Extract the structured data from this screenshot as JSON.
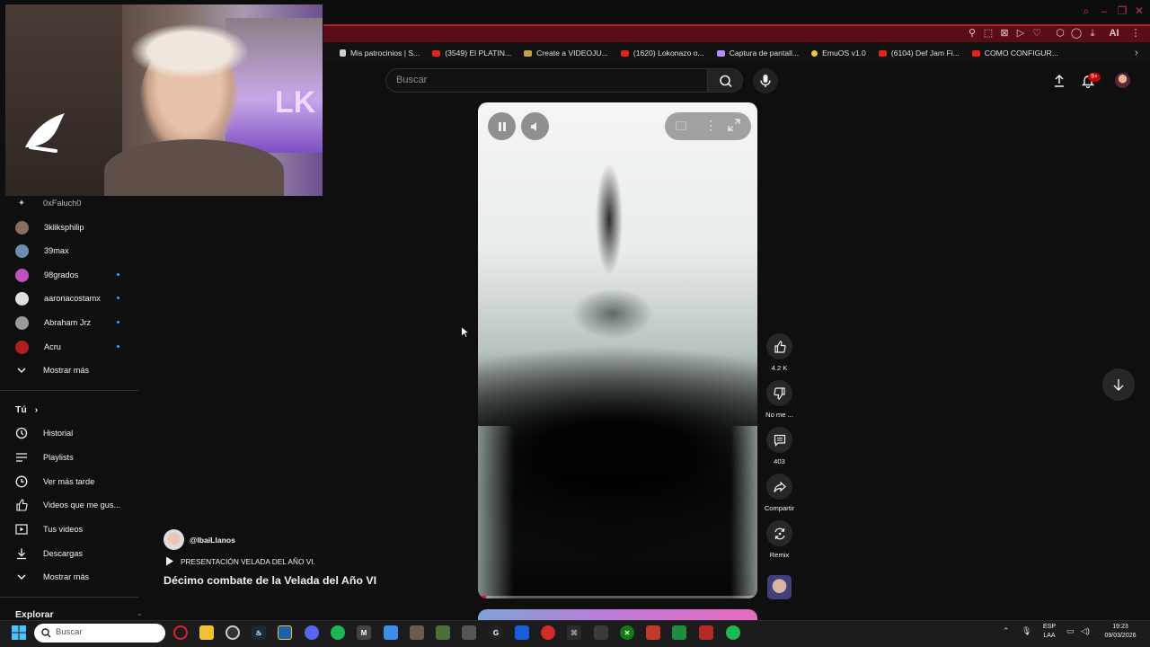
{
  "browser": {
    "bookmarks": [
      {
        "icon": "document-icon",
        "label": "Mis patrocinios | S..."
      },
      {
        "icon": "youtube-icon",
        "label": "(3549) El PLATIN..."
      },
      {
        "icon": "document-icon",
        "label": "Create a VIDEOJU..."
      },
      {
        "icon": "youtube-icon",
        "label": "(1620) Lokonazo o..."
      },
      {
        "icon": "pen-icon",
        "label": "Captura de pantall..."
      },
      {
        "icon": "emulator-icon",
        "label": "EmuOS v1.0"
      },
      {
        "icon": "youtube-icon",
        "label": "(6104) Def Jam Fi..."
      },
      {
        "icon": "youtube-icon",
        "label": "COMO CONFIGUR..."
      }
    ],
    "ai_label": "AI"
  },
  "header": {
    "search_placeholder": "Buscar",
    "notifications_badge": "9+"
  },
  "sidebar": {
    "channels": [
      {
        "name": "0xFaluch0",
        "live": false,
        "color": "#555555"
      },
      {
        "name": "3kliksphilip",
        "live": false,
        "color": "#8a6d5a"
      },
      {
        "name": "39max",
        "live": false,
        "color": "#6c8fb0"
      },
      {
        "name": "98grados",
        "live": true,
        "color": "#c04fc0"
      },
      {
        "name": "aaronacostamx",
        "live": true,
        "color": "#e0e0e0"
      },
      {
        "name": "Abraham Jrz",
        "live": true,
        "color": "#9a9a9a"
      },
      {
        "name": "Acru",
        "live": true,
        "color": "#b02020"
      }
    ],
    "show_more_1": "Mostrar más",
    "you_heading": "Tú",
    "you_items": [
      {
        "icon": "history-icon",
        "label": "Historial"
      },
      {
        "icon": "playlists-icon",
        "label": "Playlists"
      },
      {
        "icon": "watch-later-icon",
        "label": "Ver más tarde"
      },
      {
        "icon": "liked-videos-icon",
        "label": "Videos que me gus..."
      },
      {
        "icon": "your-videos-icon",
        "label": "Tus videos"
      },
      {
        "icon": "downloads-icon",
        "label": "Descargas"
      }
    ],
    "show_more_2": "Mostrar más",
    "explore_heading": "Explorar"
  },
  "short": {
    "progress": 0.03,
    "uploader": "@IbaiLlanos",
    "playlist": "PRESENTACIÓN VELADA DEL AÑO VI.",
    "title": "Décimo combate de la Velada del Año VI",
    "actions": {
      "like_count": "4.2 K",
      "dislike_label": "No me ...",
      "comments_count": "403",
      "share_label": "Compartir",
      "remix_label": "Remix"
    }
  },
  "taskbar": {
    "search_placeholder": "Buscar",
    "lang_top": "ESP",
    "lang_bottom": "LAA",
    "time": "19:23",
    "date": "09/03/2026"
  }
}
